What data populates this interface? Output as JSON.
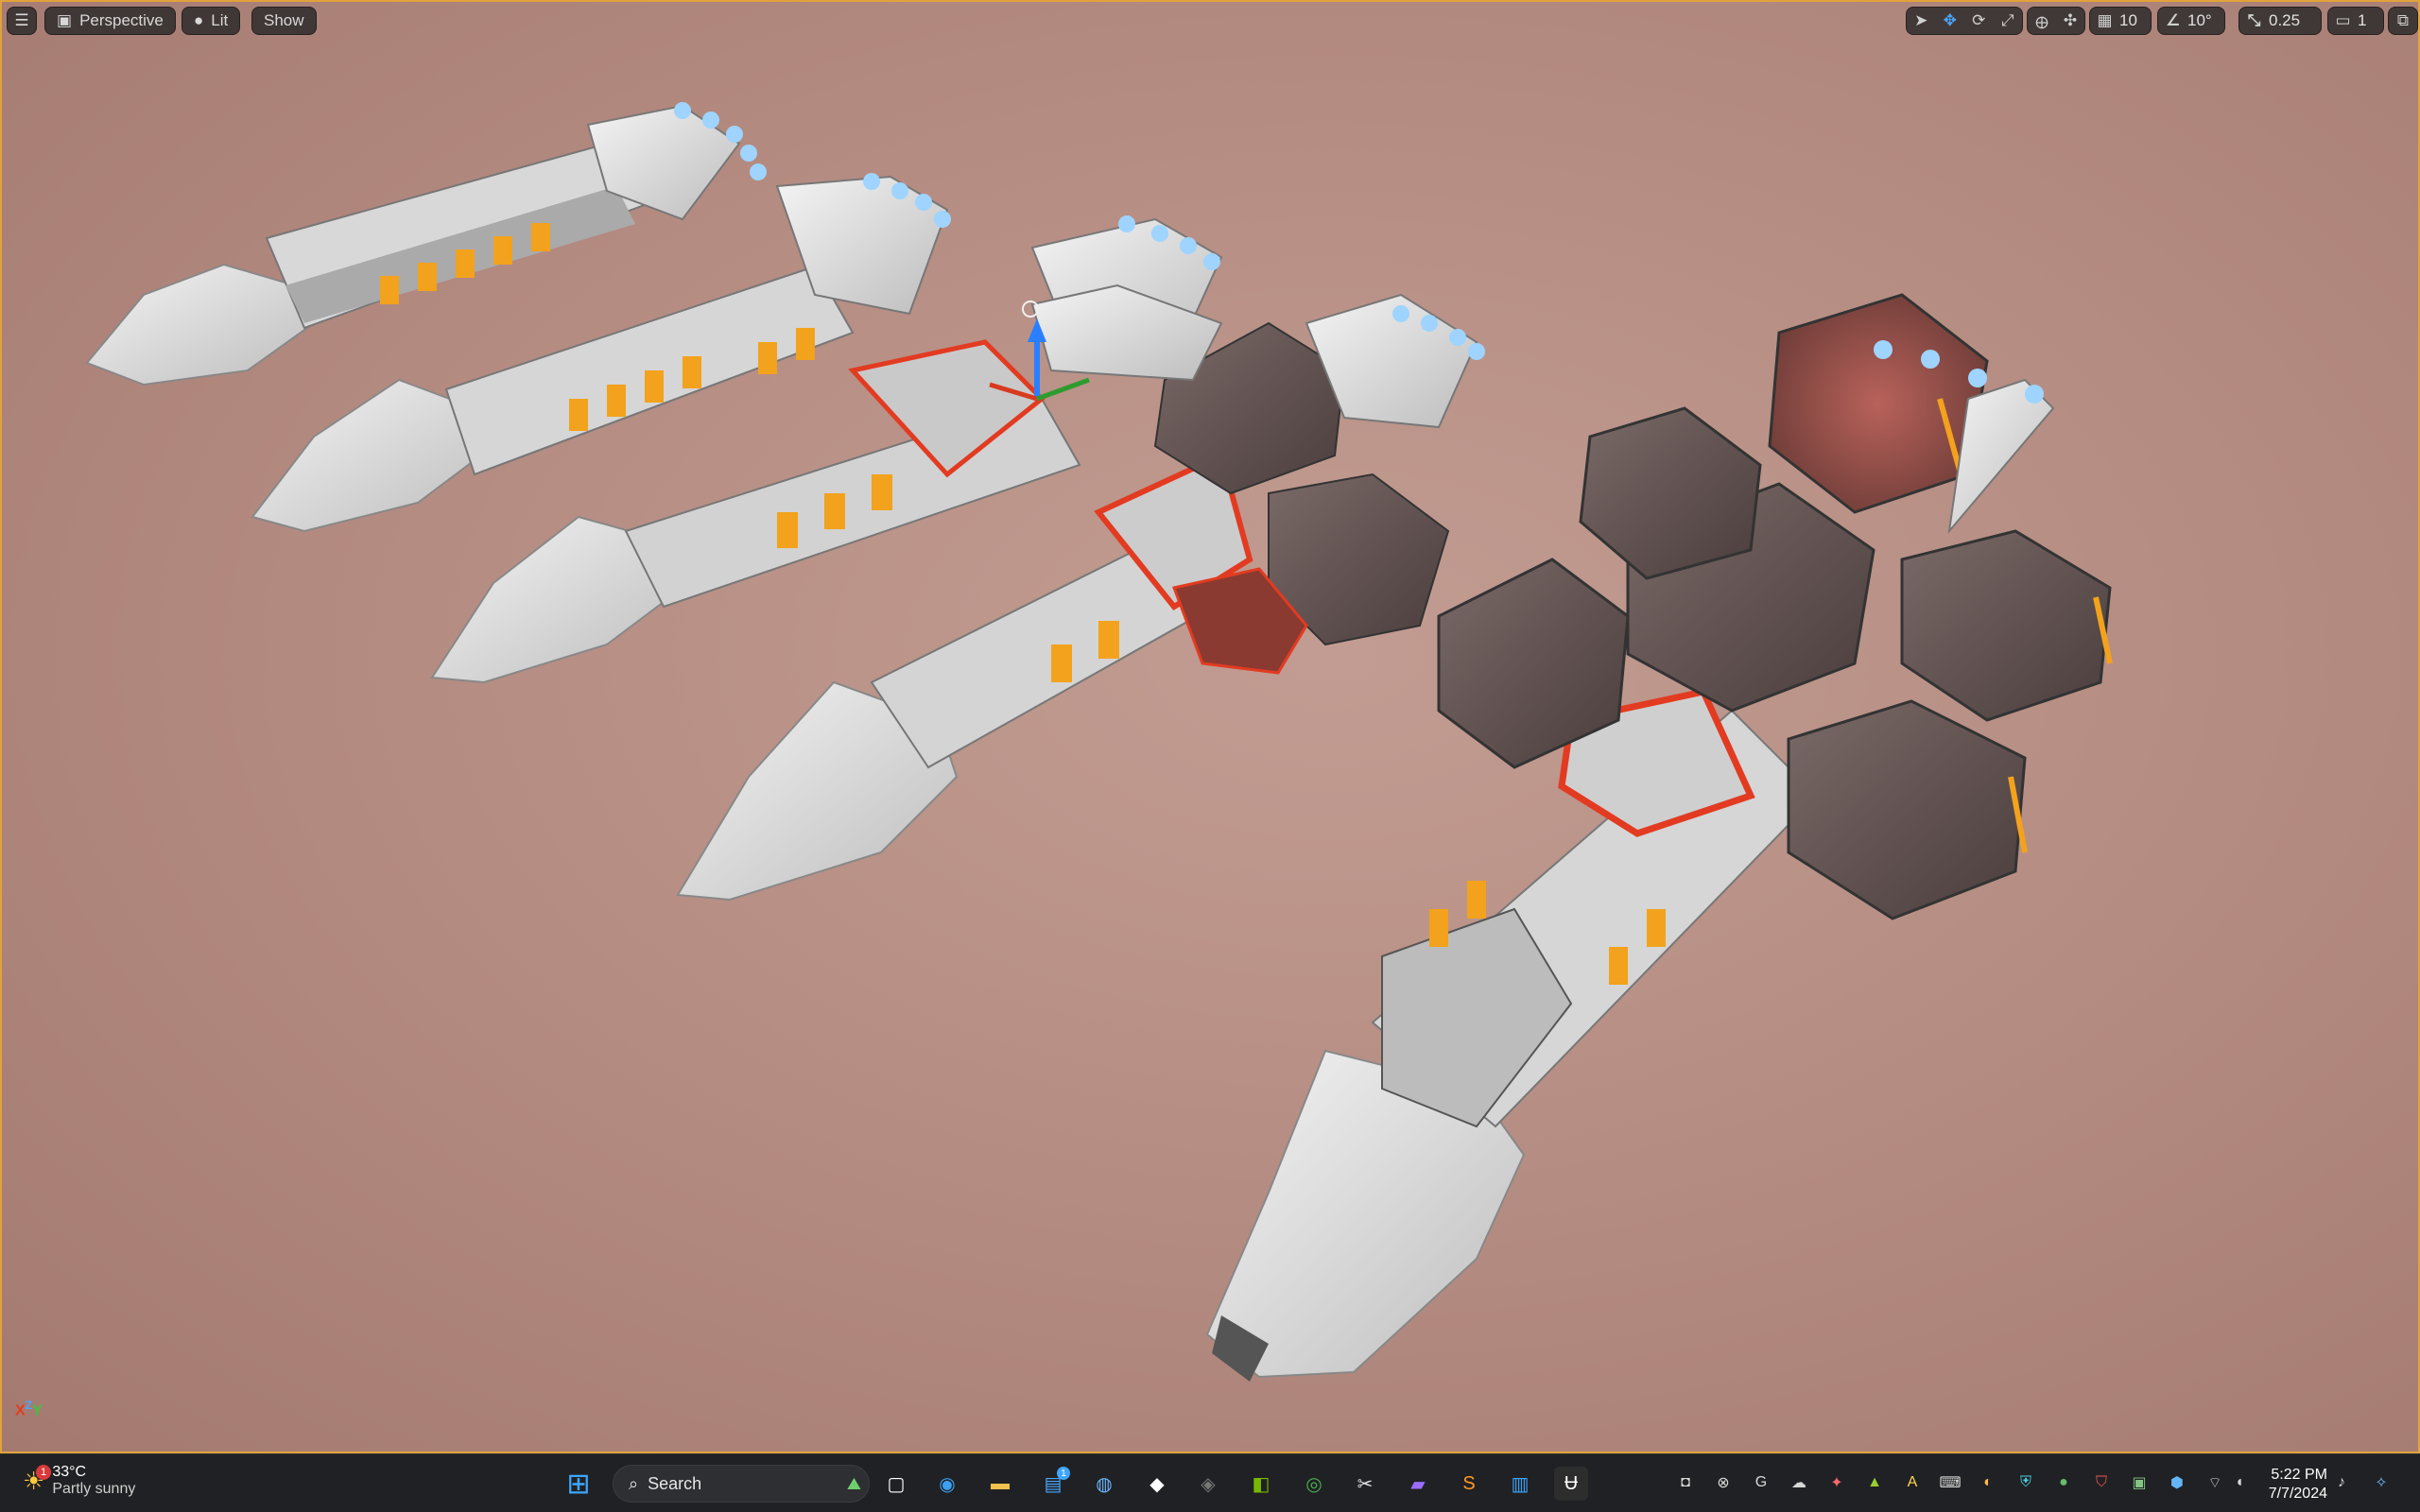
{
  "viewport": {
    "perspective_label": "Perspective",
    "lit_label": "Lit",
    "show_label": "Show",
    "grid_snap_value": "10",
    "rotation_snap_value": "10°",
    "scale_snap_value": "0.25",
    "camera_speed_value": "1",
    "axis": {
      "x": "X",
      "z": "Z",
      "y": "Y"
    },
    "colors": {
      "border": "#e2a23a",
      "background": "#b38a80",
      "accent": "#4aa7ff",
      "hull": "#e9e9e9",
      "glow_orange": "#f2a21c",
      "glow_red": "#e23b21"
    }
  },
  "taskbar": {
    "weather": {
      "temperature": "33°C",
      "condition": "Partly sunny",
      "badge": "1"
    },
    "search_placeholder": "Search",
    "store_badge": "1",
    "time": "5:22 PM",
    "date": "7/7/2024"
  }
}
